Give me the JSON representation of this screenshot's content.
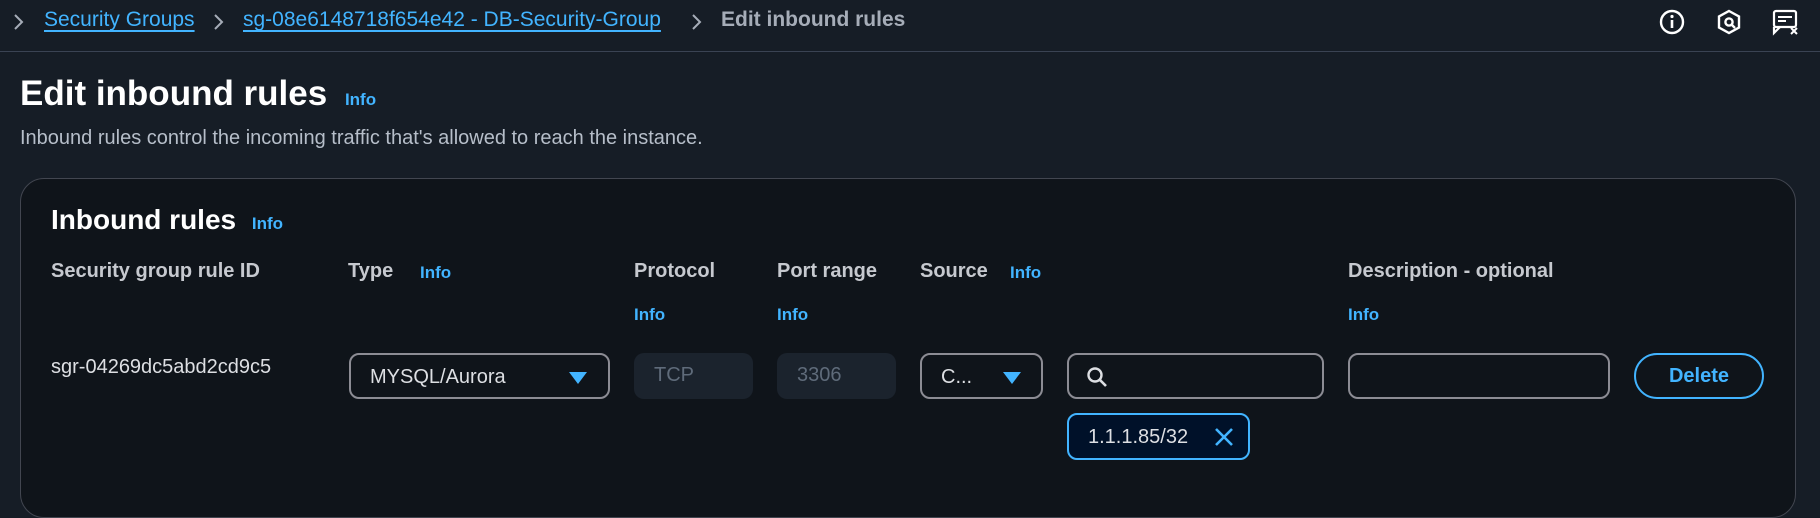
{
  "breadcrumb": {
    "items": [
      {
        "label": "Security Groups"
      },
      {
        "label": "sg-08e6148718f654e42 - DB-Security-Group"
      }
    ],
    "current": "Edit inbound rules"
  },
  "top_icons": [
    "info-circle-icon",
    "settings-hex-icon",
    "feedback-icon"
  ],
  "page": {
    "title": "Edit inbound rules",
    "info": "Info",
    "description": "Inbound rules control the incoming traffic that's allowed to reach the instance."
  },
  "panel": {
    "title": "Inbound rules",
    "info": "Info",
    "columns": {
      "rule_id": "Security group rule ID",
      "type": "Type",
      "type_info": "Info",
      "protocol": "Protocol",
      "protocol_info": "Info",
      "port_range": "Port range",
      "port_range_info": "Info",
      "source": "Source",
      "source_info": "Info",
      "description": "Description - optional",
      "description_info": "Info"
    },
    "rows": [
      {
        "rule_id": "sgr-04269dc5abd2cd9c5",
        "type": "MYSQL/Aurora",
        "protocol": "TCP",
        "port_range": "3306",
        "source_type": "C...",
        "source_search_value": "",
        "source_token": "1.1.1.85/32",
        "description": "",
        "delete_label": "Delete"
      }
    ]
  },
  "colors": {
    "background": "#161d26",
    "panel": "#0f141a",
    "link": "#42b4ff",
    "text": "#dddfe3"
  }
}
